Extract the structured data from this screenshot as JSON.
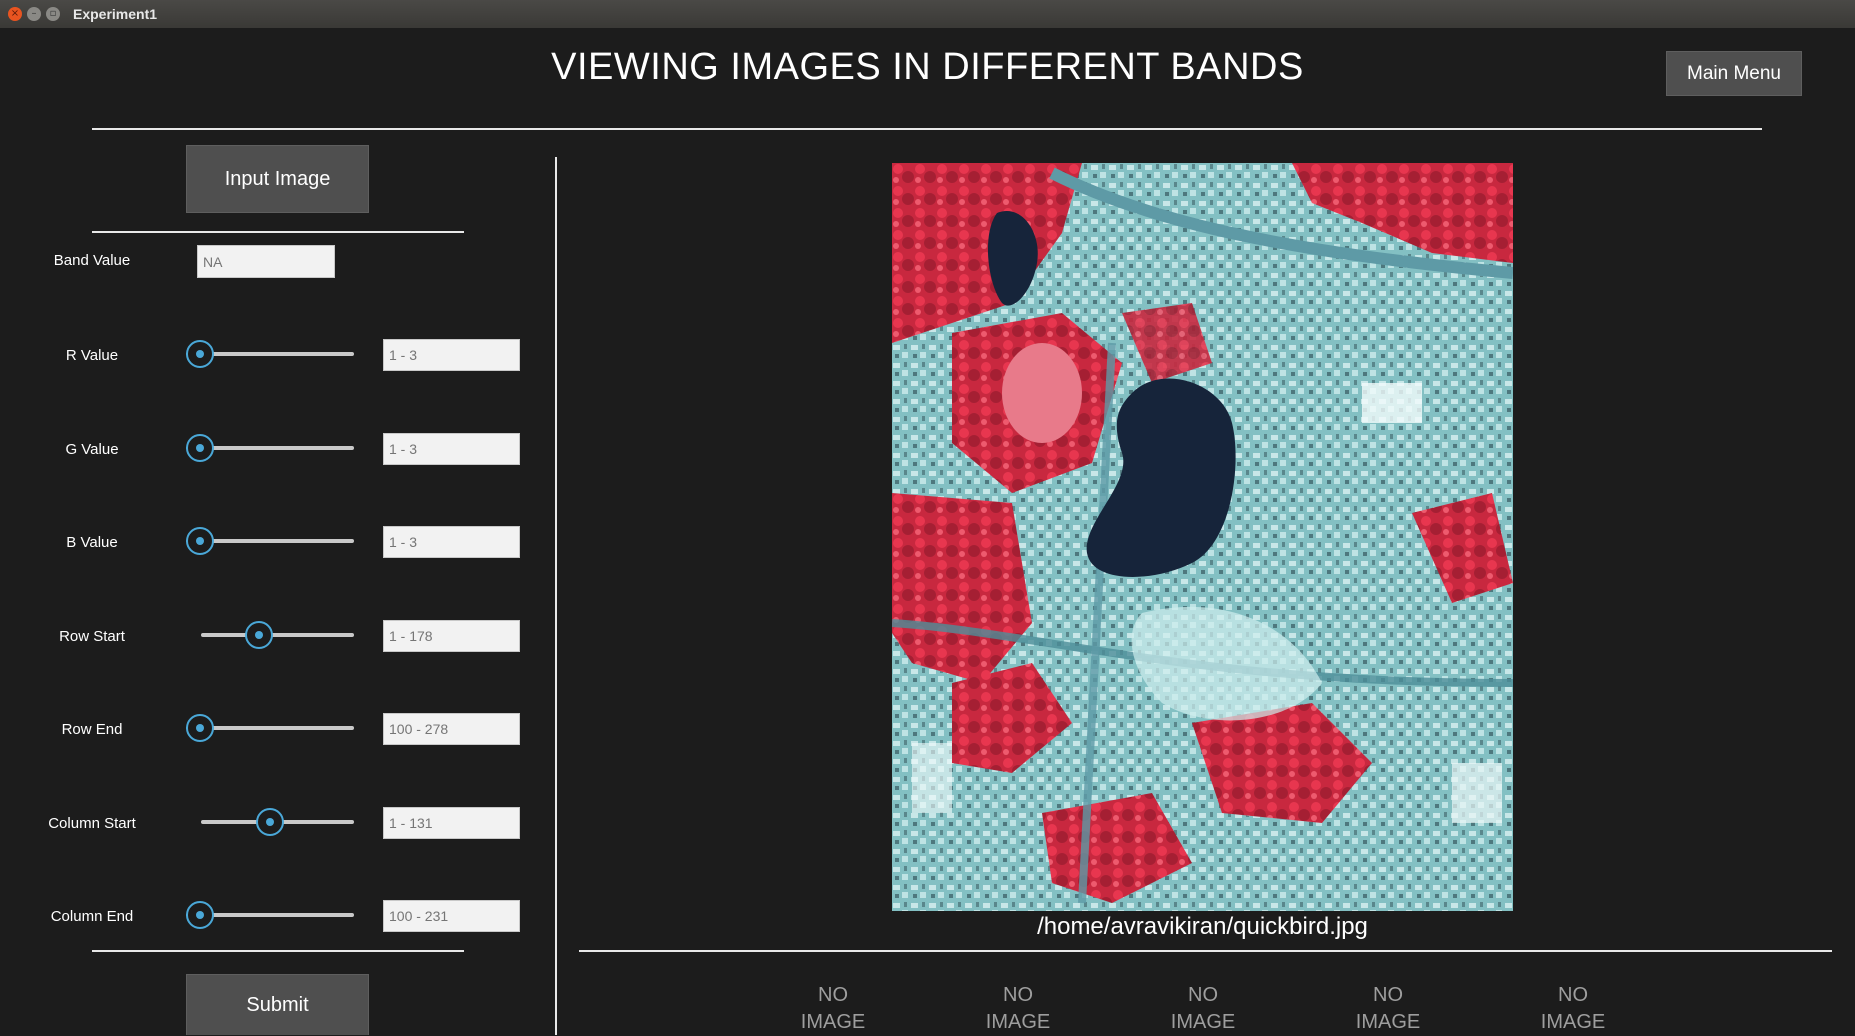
{
  "window": {
    "title": "Experiment1"
  },
  "header": {
    "title": "VIEWING IMAGES IN DIFFERENT BANDS",
    "main_menu_label": "Main Menu"
  },
  "controls": {
    "input_image_label": "Input Image",
    "band": {
      "label": "Band Value",
      "placeholder": "NA"
    },
    "sliders": [
      {
        "label": "R Value",
        "placeholder": "1 - 3",
        "level": 0.0
      },
      {
        "label": "G Value",
        "placeholder": "1 - 3",
        "level": 0.0
      },
      {
        "label": "B Value",
        "placeholder": "1 - 3",
        "level": 0.0
      },
      {
        "label": "Row Start",
        "placeholder": "1 - 178",
        "level": 0.35
      },
      {
        "label": "Row End",
        "placeholder": "100 - 278",
        "level": 0.0
      },
      {
        "label": "Column Start",
        "placeholder": "1 - 131",
        "level": 0.44
      },
      {
        "label": "Column End",
        "placeholder": "100 - 231",
        "level": 0.0
      }
    ],
    "submit_label": "Submit"
  },
  "preview": {
    "file_path": "/home/avravikiran/quickbird.jpg",
    "band_placeholders": [
      {
        "line1": "NO",
        "line2": "IMAGE"
      },
      {
        "line1": "NO",
        "line2": "IMAGE"
      },
      {
        "line1": "NO",
        "line2": "IMAGE"
      },
      {
        "line1": "NO",
        "line2": "IMAGE"
      },
      {
        "line1": "NO",
        "line2": "IMAGE"
      }
    ]
  },
  "colors": {
    "background": "#1c1c1c",
    "accent": "#4aa8d8",
    "button": "#4f4f4f"
  }
}
